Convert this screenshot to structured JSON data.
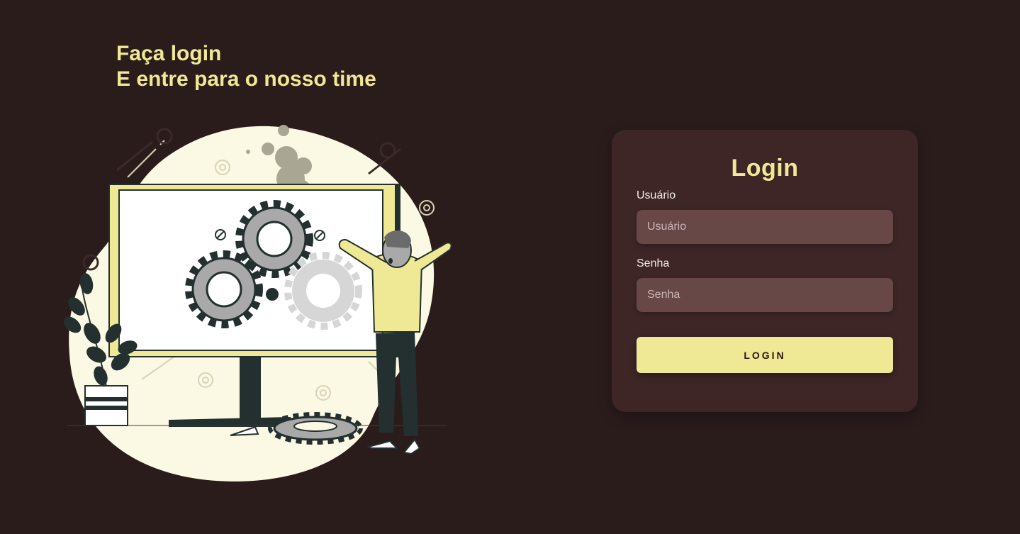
{
  "hero": {
    "line1": "Faça login",
    "line2": "E entre para o nosso time"
  },
  "login_card": {
    "title": "Login",
    "username": {
      "label": "Usuário",
      "placeholder": "Usuário",
      "value": ""
    },
    "password": {
      "label": "Senha",
      "placeholder": "Senha",
      "value": ""
    },
    "submit_label": "LOGIN"
  },
  "colors": {
    "background": "#2b1c1c",
    "card": "#3e2626",
    "input": "#684747",
    "accent": "#f0e896"
  },
  "illustration": {
    "icon": "broken-gears-monitor-illustration"
  }
}
